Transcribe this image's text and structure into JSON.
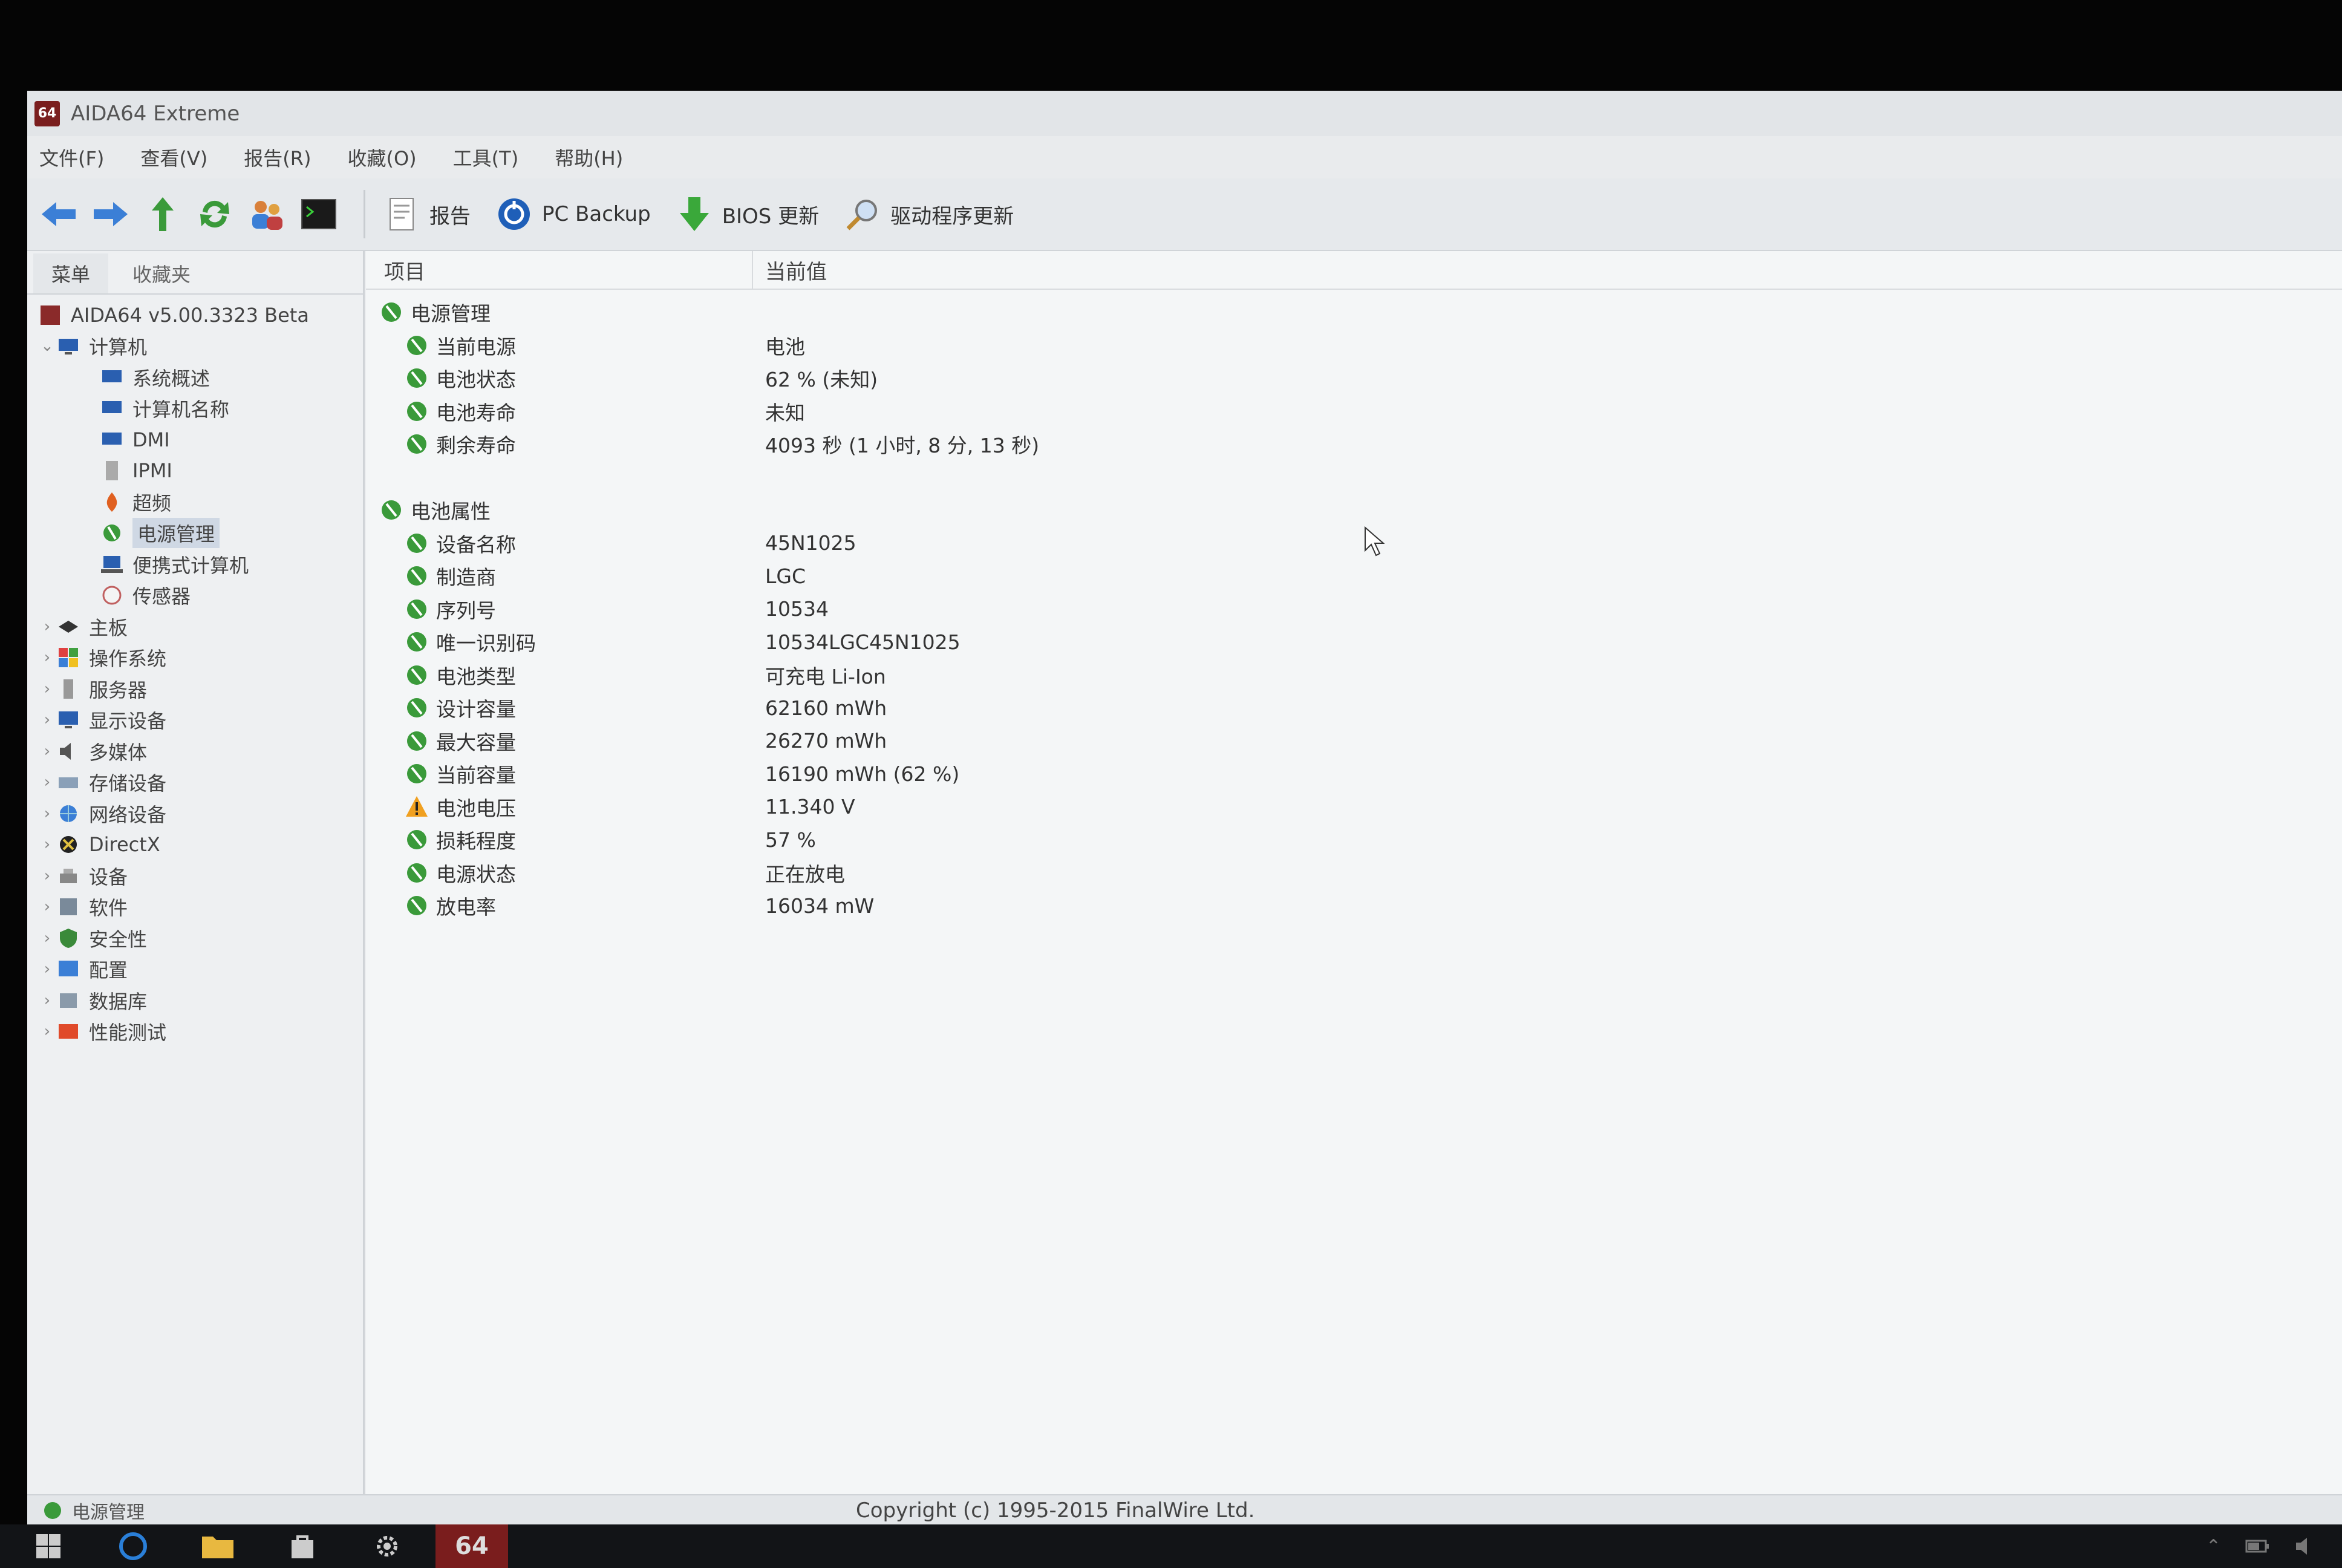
{
  "window": {
    "title": "AIDA64 Extreme",
    "app_icon_text": "64"
  },
  "menu": [
    {
      "label": "文件(F)"
    },
    {
      "label": "查看(V)"
    },
    {
      "label": "报告(R)"
    },
    {
      "label": "收藏(O)"
    },
    {
      "label": "工具(T)"
    },
    {
      "label": "帮助(H)"
    }
  ],
  "toolbar": {
    "report_label": "报告",
    "backup_label": "PC Backup",
    "bios_label": "BIOS 更新",
    "driver_label": "驱动程序更新"
  },
  "left_panel": {
    "tab_menu": "菜单",
    "tab_favorites": "收藏夹",
    "tree": [
      {
        "label": "AIDA64 v5.00.3323 Beta"
      },
      {
        "label": "计算机"
      },
      {
        "label": "系统概述"
      },
      {
        "label": "计算机名称"
      },
      {
        "label": "DMI"
      },
      {
        "label": "IPMI"
      },
      {
        "label": "超频"
      },
      {
        "label": "电源管理"
      },
      {
        "label": "便携式计算机"
      },
      {
        "label": "传感器"
      },
      {
        "label": "主板"
      },
      {
        "label": "操作系统"
      },
      {
        "label": "服务器"
      },
      {
        "label": "显示设备"
      },
      {
        "label": "多媒体"
      },
      {
        "label": "存储设备"
      },
      {
        "label": "网络设备"
      },
      {
        "label": "DirectX"
      },
      {
        "label": "设备"
      },
      {
        "label": "软件"
      },
      {
        "label": "安全性"
      },
      {
        "label": "配置"
      },
      {
        "label": "数据库"
      },
      {
        "label": "性能测试"
      }
    ]
  },
  "columns": {
    "item": "项目",
    "value": "当前值"
  },
  "groups": [
    {
      "title": "电源管理",
      "rows": [
        {
          "field": "当前电源",
          "value": "电池"
        },
        {
          "field": "电池状态",
          "value": "62 % (未知)"
        },
        {
          "field": "电池寿命",
          "value": "未知"
        },
        {
          "field": "剩余寿命",
          "value": "4093 秒 (1 小时, 8 分, 13 秒)"
        }
      ]
    },
    {
      "title": "电池属性",
      "rows": [
        {
          "field": "设备名称",
          "value": "45N1025"
        },
        {
          "field": "制造商",
          "value": "LGC"
        },
        {
          "field": "序列号",
          "value": "10534"
        },
        {
          "field": "唯一识别码",
          "value": "10534LGC45N1025"
        },
        {
          "field": "电池类型",
          "value": "可充电 Li-Ion"
        },
        {
          "field": "设计容量",
          "value": "62160 mWh"
        },
        {
          "field": "最大容量",
          "value": "26270 mWh"
        },
        {
          "field": "当前容量",
          "value": "16190 mWh  (62 %)"
        },
        {
          "field": "电池电压",
          "value": "11.340 V"
        },
        {
          "field": "损耗程度",
          "value": "57 %"
        },
        {
          "field": "电源状态",
          "value": "正在放电"
        },
        {
          "field": "放电率",
          "value": "16034 mW"
        }
      ]
    }
  ],
  "statusbar": {
    "left": "电源管理",
    "copyright": "Copyright (c) 1995-2015 FinalWire Ltd."
  },
  "taskbar": {
    "active_app_label": "64"
  },
  "colors": {
    "accent_blue": "#2a6fd1",
    "nav_green": "#3a9a3a",
    "warning": "#f0a020",
    "taskbar": "#121417",
    "active_task": "#7a1d1d"
  }
}
